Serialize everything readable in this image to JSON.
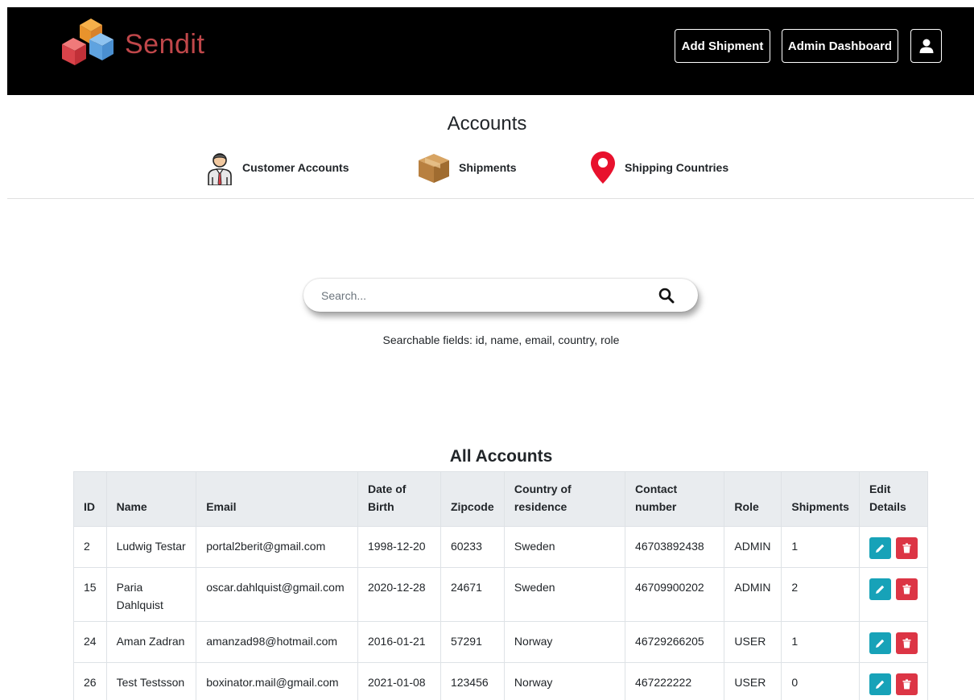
{
  "header": {
    "brand": "Sendit",
    "add_shipment": "Add Shipment",
    "admin_dashboard": "Admin Dashboard",
    "user_icon": "user-icon",
    "colors": {
      "background": "#000000",
      "brand": "#c0474a"
    }
  },
  "accounts_nav": {
    "title": "Accounts",
    "items": [
      {
        "label": "Customer Accounts",
        "icon": "person-icon"
      },
      {
        "label": "Shipments",
        "icon": "package-icon"
      },
      {
        "label": "Shipping Countries",
        "icon": "map-pin-icon"
      }
    ]
  },
  "search": {
    "placeholder": "Search...",
    "value": "",
    "hint": "Searchable fields: id, name, email, country, role",
    "icon": "search-icon"
  },
  "table": {
    "title": "All Accounts",
    "headers": [
      "ID",
      "Name",
      "Email",
      "Date of Birth",
      "Zipcode",
      "Country of residence",
      "Contact number",
      "Role",
      "Shipments",
      "Edit Details"
    ],
    "rows": [
      [
        "2",
        "Ludwig Testar",
        "portal2berit@gmail.com",
        "1998-12-20",
        "60233",
        "Sweden",
        "46703892438",
        "ADMIN",
        "1"
      ],
      [
        "15",
        "Paria Dahlquist",
        "oscar.dahlquist@gmail.com",
        "2020-12-28",
        "24671",
        "Sweden",
        "46709900202",
        "ADMIN",
        "2"
      ],
      [
        "24",
        "Aman Zadran",
        "amanzad98@hotmail.com",
        "2016-01-21",
        "57291",
        "Norway",
        "46729266205",
        "USER",
        "1"
      ],
      [
        "26",
        "Test Testsson",
        "boxinator.mail@gmail.com",
        "2021-01-08",
        "123456",
        "Norway",
        "467222222",
        "USER",
        "0"
      ]
    ],
    "action_icons": {
      "edit": "pencil-icon",
      "delete": "trash-icon"
    },
    "colors": {
      "edit": "#17a2b8",
      "delete": "#dc3545",
      "header_bg": "#e9ecef"
    }
  }
}
